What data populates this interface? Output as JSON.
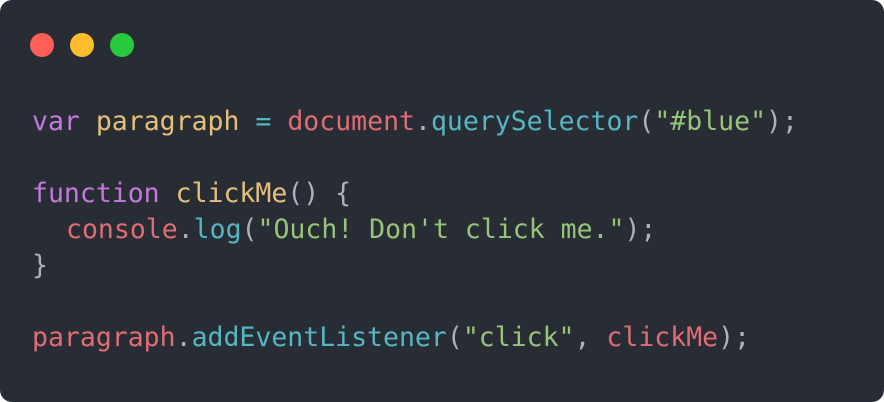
{
  "window": {
    "background": "#282c34",
    "controls": [
      {
        "name": "close",
        "color": "#ff5f56"
      },
      {
        "name": "minimize",
        "color": "#ffbd2e"
      },
      {
        "name": "maximize",
        "color": "#27c93f"
      }
    ]
  },
  "colors": {
    "keyword": "#c678dd",
    "variable": "#e06c75",
    "function": "#e5c07b",
    "method": "#56b6c2",
    "string": "#98c379",
    "punctuation": "#abb2bf"
  },
  "code": {
    "lines": [
      [
        {
          "text": "var",
          "type": "keyword"
        },
        {
          "text": " ",
          "type": "punctuation"
        },
        {
          "text": "paragraph",
          "type": "function"
        },
        {
          "text": " ",
          "type": "punctuation"
        },
        {
          "text": "=",
          "type": "method"
        },
        {
          "text": " ",
          "type": "punctuation"
        },
        {
          "text": "document",
          "type": "variable"
        },
        {
          "text": ".",
          "type": "punctuation"
        },
        {
          "text": "querySelector",
          "type": "method"
        },
        {
          "text": "(",
          "type": "punctuation"
        },
        {
          "text": "\"#blue\"",
          "type": "string"
        },
        {
          "text": ");",
          "type": "punctuation"
        }
      ],
      [],
      [
        {
          "text": "function",
          "type": "keyword"
        },
        {
          "text": " ",
          "type": "punctuation"
        },
        {
          "text": "clickMe",
          "type": "function"
        },
        {
          "text": "() {",
          "type": "punctuation"
        }
      ],
      [
        {
          "text": "  ",
          "type": "indent"
        },
        {
          "text": "console",
          "type": "variable"
        },
        {
          "text": ".",
          "type": "punctuation"
        },
        {
          "text": "log",
          "type": "method"
        },
        {
          "text": "(",
          "type": "punctuation"
        },
        {
          "text": "\"Ouch! Don't click me.\"",
          "type": "string"
        },
        {
          "text": ");",
          "type": "punctuation"
        }
      ],
      [
        {
          "text": "}",
          "type": "punctuation"
        }
      ],
      [],
      [
        {
          "text": "paragraph",
          "type": "variable"
        },
        {
          "text": ".",
          "type": "punctuation"
        },
        {
          "text": "addEventListener",
          "type": "method"
        },
        {
          "text": "(",
          "type": "punctuation"
        },
        {
          "text": "\"click\"",
          "type": "string"
        },
        {
          "text": ", ",
          "type": "punctuation"
        },
        {
          "text": "clickMe",
          "type": "variable"
        },
        {
          "text": ");",
          "type": "punctuation"
        }
      ]
    ]
  }
}
